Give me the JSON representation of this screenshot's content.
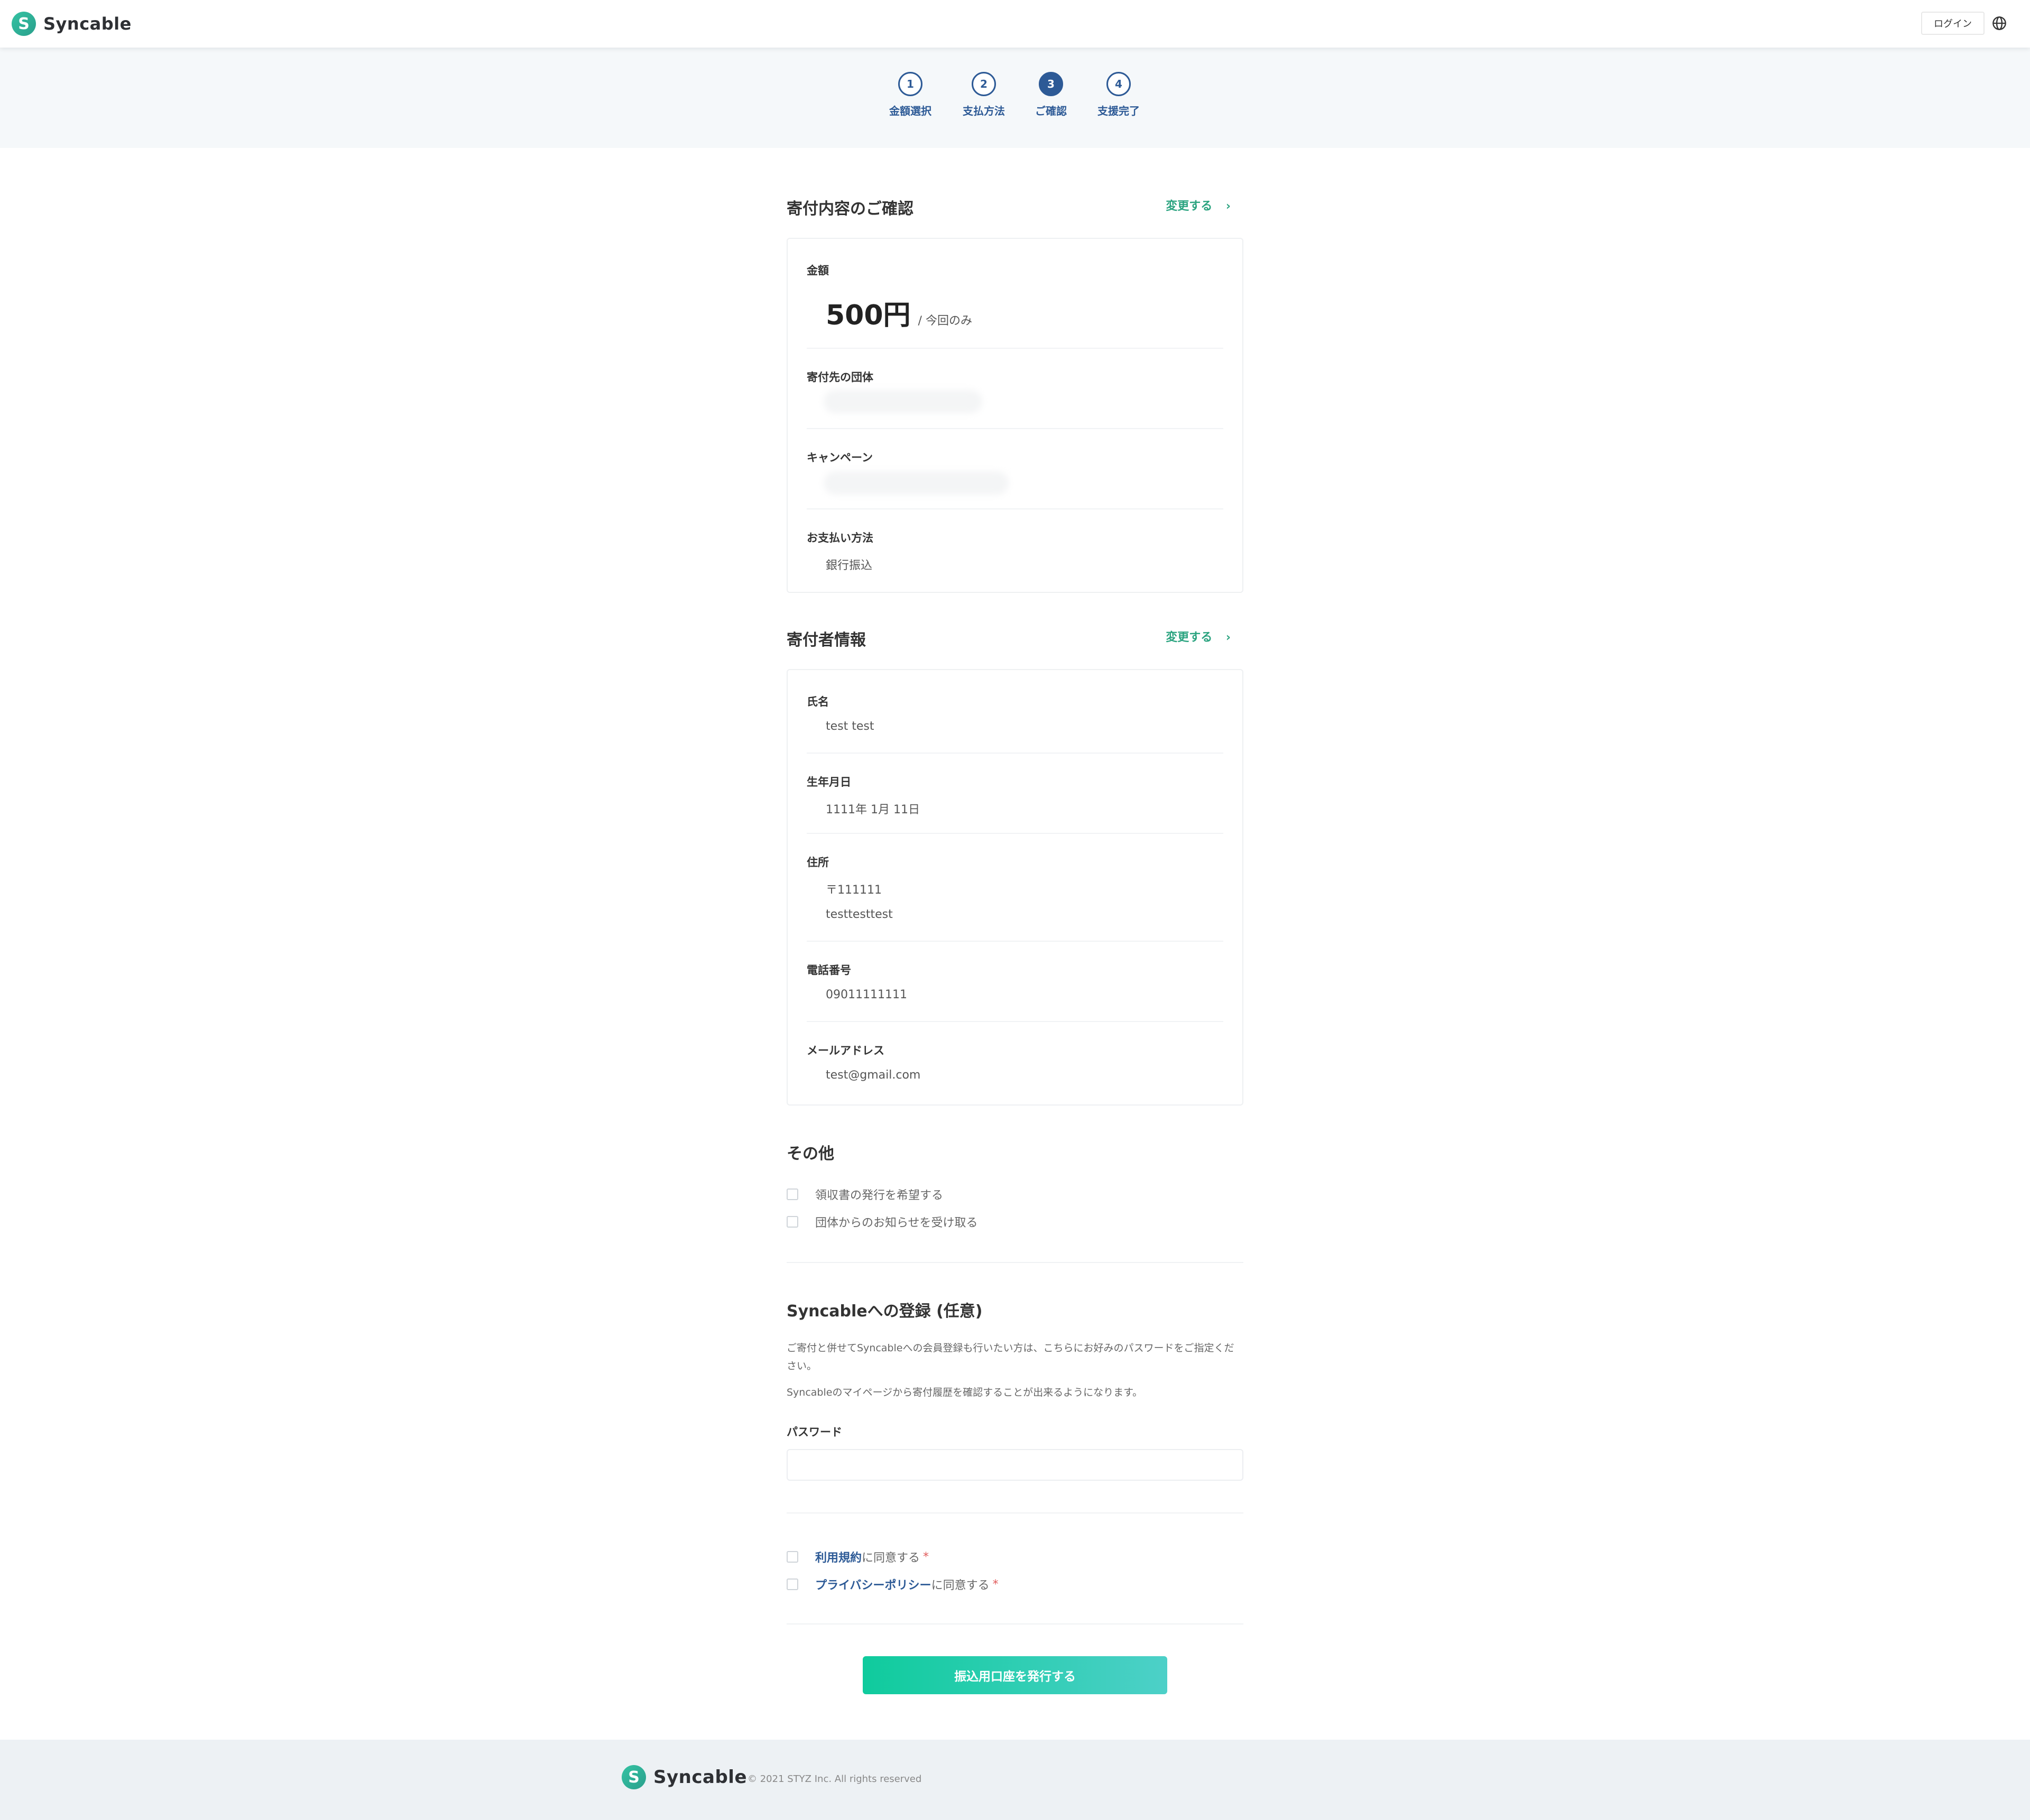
{
  "header": {
    "logo_mark": "S",
    "logo_text": "Syncable",
    "login_label": "ログイン",
    "language_icon": "globe-icon"
  },
  "steps": [
    {
      "number": "1",
      "label": "金額選択",
      "state": "done"
    },
    {
      "number": "2",
      "label": "支払方法",
      "state": "done"
    },
    {
      "number": "3",
      "label": "ご確認",
      "state": "active"
    },
    {
      "number": "4",
      "label": "支援完了",
      "state": "upcoming"
    }
  ],
  "donation": {
    "title": "寄付内容のご確認",
    "change_label": "変更する",
    "amount_label": "金額",
    "amount_value": "500円",
    "amount_suffix": "/ 今回のみ",
    "org_label": "寄付先の団体",
    "campaign_label": "キャンペーン",
    "payment_label": "お支払い方法",
    "payment_value": "銀行振込"
  },
  "donor": {
    "title": "寄付者情報",
    "change_label": "変更する",
    "name_label": "氏名",
    "name_value": "test test",
    "birth_label": "生年月日",
    "birth_value": "1111年 1月 11日",
    "address_label": "住所",
    "postal_value": "〒111111",
    "address_value": "testtesttest",
    "phone_label": "電話番号",
    "phone_value": "09011111111",
    "email_label": "メールアドレス",
    "email_value": "test@gmail.com"
  },
  "other": {
    "title": "その他",
    "receipt_label": "領収書の発行を希望する",
    "news_label": "団体からのお知らせを受け取る"
  },
  "register": {
    "title": "Syncableへの登録 (任意)",
    "desc1": "ご寄付と併せてSyncableへの会員登録も行いたい方は、こちらにお好みのパスワードをご指定ください。",
    "desc2": "Syncableのマイページから寄付履歴を確認することが出来るようになります。",
    "password_label": "パスワード",
    "password_value": ""
  },
  "agreements": {
    "terms_link": "利用規約",
    "terms_suffix": "に同意する",
    "privacy_link": "プライバシーポリシー",
    "privacy_suffix": "に同意する",
    "required_mark": "*"
  },
  "submit_label": "振込用口座を発行する",
  "footer": {
    "logo_mark": "S",
    "logo_text": "Syncable",
    "copyright": "© 2021 STYZ Inc. All rights reserved"
  },
  "colors": {
    "brand_green": "#2aa37f",
    "step_blue": "#2d5a96",
    "button_start": "#0fcb9d",
    "button_end": "#4dd0c8"
  }
}
